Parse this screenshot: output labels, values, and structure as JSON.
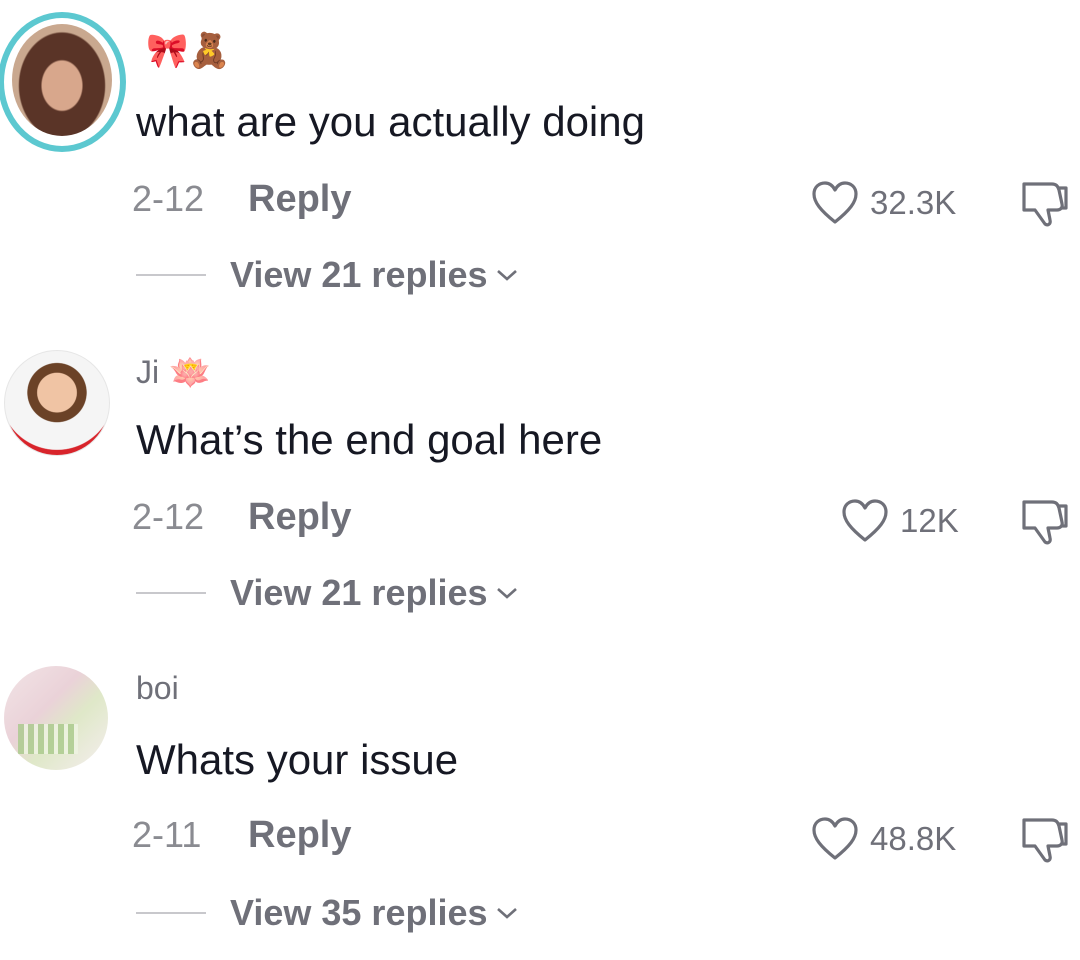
{
  "comments": [
    {
      "username": "",
      "username_emoji": "🎀🧸",
      "text": "what are you actually doing",
      "date": "2-12",
      "reply_label": "Reply",
      "likes": "32.3K",
      "view_replies": "View 21 replies"
    },
    {
      "username": "Ji",
      "username_emoji": "🪷",
      "text": "What’s the end goal here",
      "date": "2-12",
      "reply_label": "Reply",
      "likes": "12K",
      "view_replies": "View 21 replies"
    },
    {
      "username": "boi",
      "username_emoji": "",
      "text": "Whats your issue",
      "date": "2-11",
      "reply_label": "Reply",
      "likes": "48.8K",
      "view_replies": "View 35 replies"
    }
  ],
  "icons": {
    "like": "heart-outline-icon",
    "dislike": "thumbs-down-outline-icon",
    "expand": "chevron-down-icon"
  },
  "colors": {
    "story_ring": "#5cc8d0",
    "text_primary": "#161823",
    "text_secondary": "#6f7079"
  }
}
